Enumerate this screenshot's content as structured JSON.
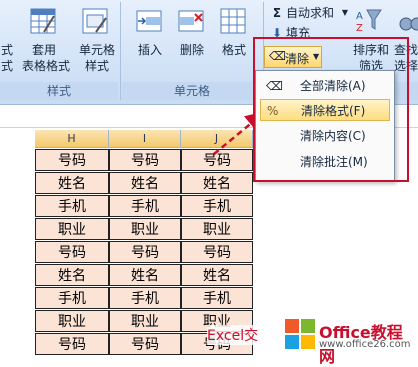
{
  "ribbon": {
    "left_cut_top": "式",
    "left_cut_bottom": "式",
    "table_format_line1": "套用",
    "table_format_line2": "表格格式",
    "cell_style_line1": "单元格",
    "cell_style_line2": "样式",
    "style_group_label": "样式",
    "insert_label": "插入",
    "delete_label": "删除",
    "format_label": "格式",
    "cells_group_label": "单元格",
    "autosum_label": "自动求和",
    "fill_label": "填充",
    "clear_label": "清除",
    "sort_line1": "排序和",
    "sort_line2": "筛选",
    "find_line1": "查找",
    "find_line2": "选择"
  },
  "columns": [
    "H",
    "I",
    "J"
  ],
  "table_rows": [
    "号码",
    "姓名",
    "手机",
    "职业",
    "号码",
    "姓名",
    "手机",
    "职业",
    "号码"
  ],
  "clear_menu": {
    "items": [
      "全部清除(A)",
      "清除格式(F)",
      "清除内容(C)",
      "清除批注(M)"
    ],
    "highlighted_index": 1
  },
  "watermark": {
    "brand": "Office教程网",
    "url": "www.office26.com",
    "caption": "Excel交"
  },
  "colors": {
    "cell_fill": "#fbe3d6",
    "highlight_box": "#c8102e",
    "arrow": "#c8102e"
  }
}
